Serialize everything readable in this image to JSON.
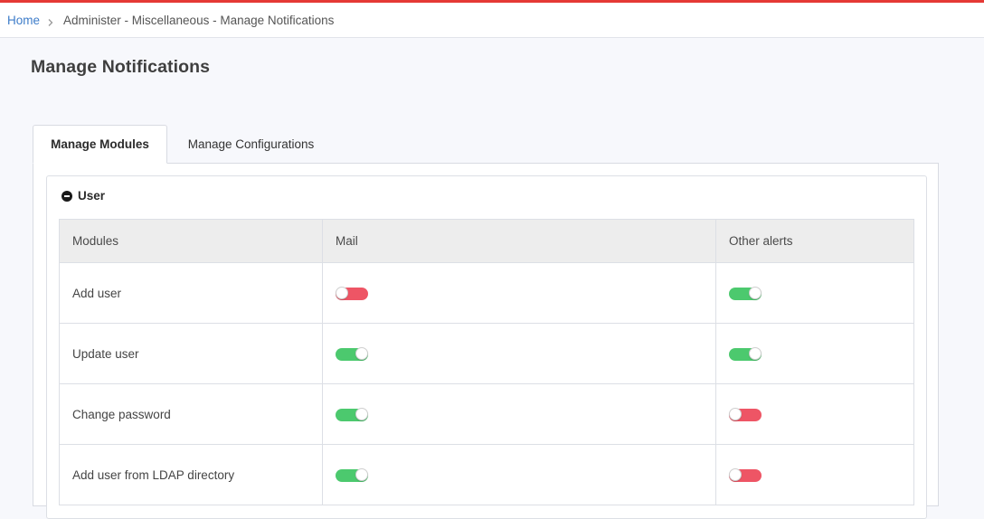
{
  "breadcrumb": {
    "home": "Home",
    "path": "Administer - Miscellaneous - Manage Notifications"
  },
  "page_title": "Manage Notifications",
  "tabs": [
    {
      "label": "Manage Modules",
      "active": true
    },
    {
      "label": "Manage Configurations",
      "active": false
    }
  ],
  "section": {
    "title": "User",
    "columns": [
      "Modules",
      "Mail",
      "Other alerts"
    ],
    "rows": [
      {
        "module": "Add user",
        "mail": false,
        "other_alerts": true
      },
      {
        "module": "Update user",
        "mail": true,
        "other_alerts": true
      },
      {
        "module": "Change password",
        "mail": true,
        "other_alerts": false
      },
      {
        "module": "Add user from LDAP directory",
        "mail": true,
        "other_alerts": false
      }
    ]
  },
  "colors": {
    "accent_top": "#e53935",
    "toggle_on": "#4cc96e",
    "toggle_off": "#ee5565",
    "link": "#3d7cc9"
  }
}
